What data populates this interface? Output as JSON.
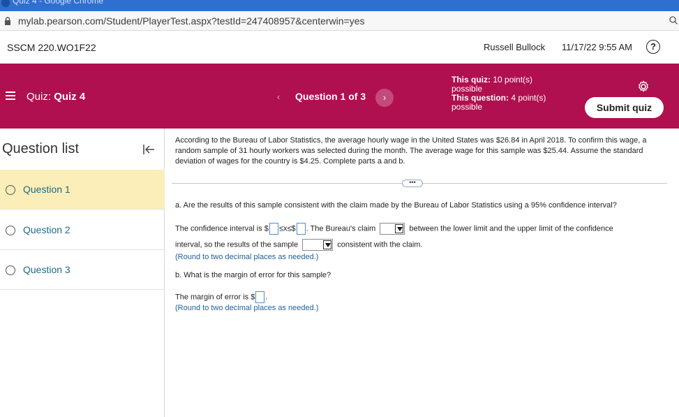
{
  "browser": {
    "tab_title": "Quiz 4 - Google Chrome",
    "url": "mylab.pearson.com/Student/PlayerTest.aspx?testId=247408957&centerwin=yes"
  },
  "course_bar": {
    "course": "SSCM 220.WO1F22",
    "user": "Russell Bullock",
    "datetime": "11/17/22 9:55 AM",
    "help_label": "?"
  },
  "header": {
    "quiz_prefix": "Quiz:",
    "quiz_name": "Quiz 4",
    "prev_label": "‹",
    "question_counter": "Question 1 of 3",
    "next_label": "›",
    "quiz_points_label": "This quiz:",
    "quiz_points_value": "10 point(s) possible",
    "question_points_label": "This question:",
    "question_points_value": "4 point(s) possible",
    "submit_label": "Submit quiz",
    "accent": "#b0104f"
  },
  "sidebar": {
    "title": "Question list",
    "items": [
      {
        "label": "Question 1"
      },
      {
        "label": "Question 2"
      },
      {
        "label": "Question 3"
      }
    ]
  },
  "question": {
    "prompt": "According to the Bureau of Labor Statistics, the average hourly wage in the United States was $26.84 in April 2018. To confirm this wage, a random sample of 31 hourly workers was selected during the month. The average wage for this sample was $25.44. Assume the standard deviation of wages for the country is $4.25. Complete parts a and b.",
    "more_label": "•••",
    "part_a": "a. Are the results of this sample consistent with the claim made by the Bureau of Labor Statistics using a 95% confidence interval?",
    "ci_prefix": "The confidence interval is $",
    "ci_middle": "≤x≤$",
    "ci_suffix": ". The Bureau's claim",
    "claim_suffix": "between the lower limit and the upper limit of the confidence",
    "line2_prefix": "interval, so the results of the sample",
    "line2_suffix": "consistent with the claim.",
    "hint": "(Round to two decimal places as needed.)",
    "part_b": "b. What is the margin of error for this sample?",
    "moe_prefix": "The margin of error is $",
    "moe_suffix": ".",
    "hint2": "(Round to two decimal places as needed.)"
  }
}
